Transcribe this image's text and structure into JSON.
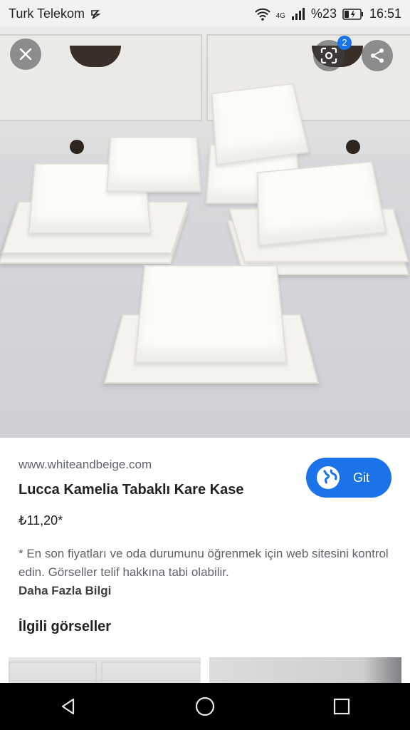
{
  "status_bar": {
    "carrier": "Turk Telekom",
    "network": "4G",
    "battery": "%23",
    "time": "16:51"
  },
  "viewer": {
    "lens_badge_count": "2",
    "close_icon": "close-icon",
    "lens_icon": "lens-icon",
    "share_icon": "share-icon"
  },
  "result": {
    "source": "www.whiteandbeige.com",
    "title": "Lucca Kamelia Tabaklı Kare Kase",
    "price": "₺11,20*",
    "disclaimer": "* En son fiyatları ve oda durumunu öğrenmek için web sitesini kontrol edin. Görseller telif hakkına tabi olabilir.",
    "more_info": "Daha Fazla Bilgi",
    "visit_label": "Git",
    "related_title": "İlgili görseller"
  },
  "colors": {
    "accent": "#1a73e8",
    "nav_bar": "#000000"
  }
}
